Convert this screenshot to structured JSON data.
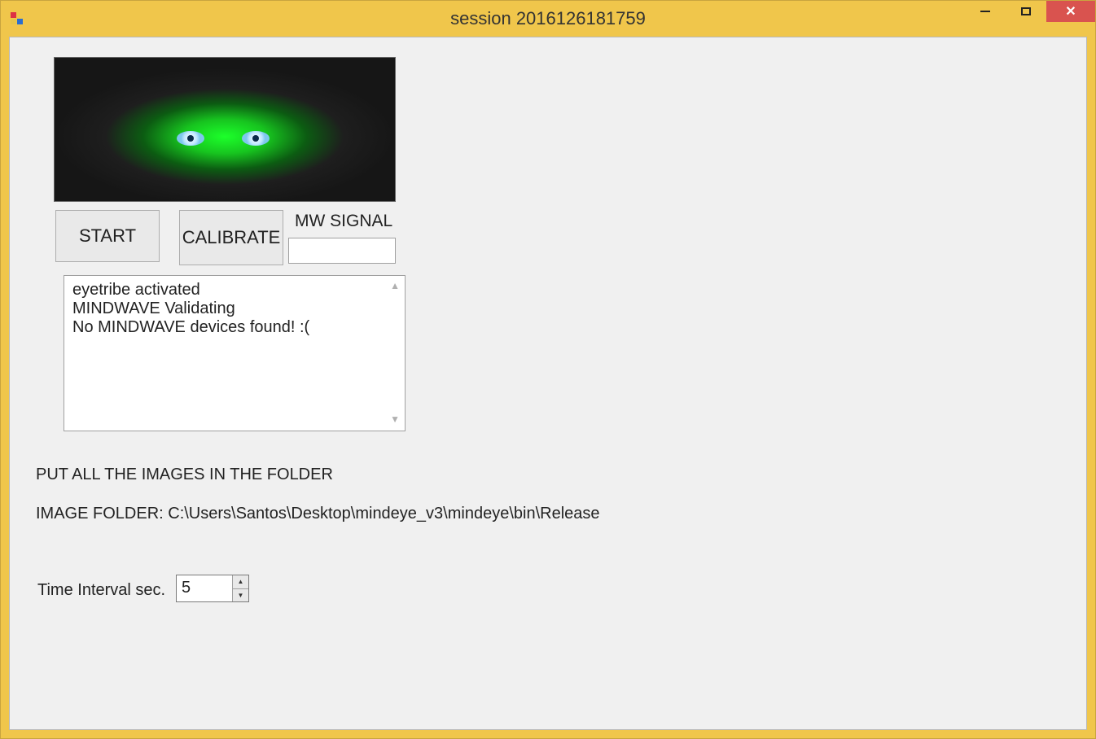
{
  "window": {
    "title": "session 2016126181759"
  },
  "controls": {
    "start_label": "START",
    "calibrate_label": "CALIBRATE",
    "mw_signal_label": "MW SIGNAL",
    "mw_signal_value": ""
  },
  "log": {
    "lines": "eyetribe activated\nMINDWAVE Validating\nNo MINDWAVE devices found! :("
  },
  "instructions": {
    "put_images": "PUT ALL THE IMAGES IN THE FOLDER",
    "image_folder": "IMAGE FOLDER: C:\\Users\\Santos\\Desktop\\mindeye_v3\\mindeye\\bin\\Release"
  },
  "interval": {
    "label": "Time Interval sec.",
    "value": "5"
  }
}
